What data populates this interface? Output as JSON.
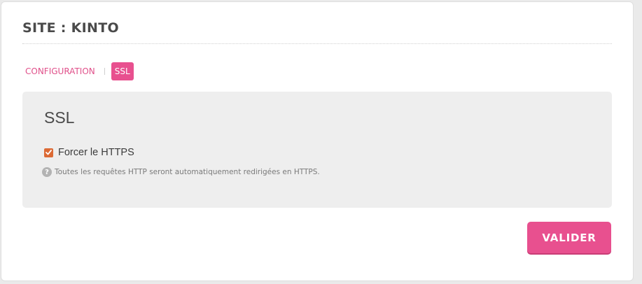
{
  "header": {
    "title": "SITE : KINTO"
  },
  "tabs": [
    {
      "label": "CONFIGURATION",
      "active": false
    },
    {
      "label": "SSL",
      "active": true
    }
  ],
  "ssl_panel": {
    "title": "SSL",
    "force_https": {
      "label": "Forcer le HTTPS",
      "checked": true
    },
    "help": {
      "icon": "question-circle-icon",
      "text": "Toutes les requêtes HTTP seront automatiquement redirigées en HTTPS."
    }
  },
  "actions": {
    "submit_label": "VALIDER"
  },
  "colors": {
    "accent": "#e8508f",
    "checkbox": "#dc6a35",
    "panel_bg": "#eeeeee"
  }
}
